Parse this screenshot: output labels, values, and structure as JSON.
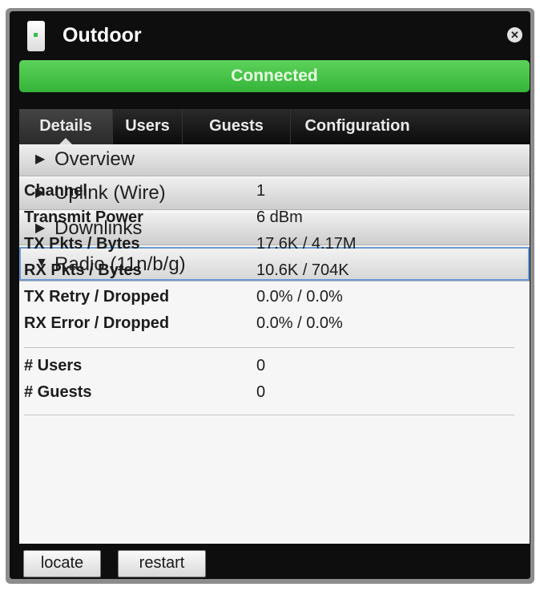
{
  "window": {
    "title": "Outdoor",
    "status": "Connected",
    "close_icon": "close-icon"
  },
  "tabs": [
    {
      "label": "Details",
      "active": true
    },
    {
      "label": "Users",
      "active": false
    },
    {
      "label": "Guests",
      "active": false
    },
    {
      "label": "Configuration",
      "active": false
    }
  ],
  "sections": [
    {
      "title": "Overview",
      "expanded": false
    },
    {
      "title": "Uplink (Wire)",
      "expanded": false
    },
    {
      "title": "Downlinks",
      "expanded": false
    },
    {
      "title": "Radio (11n/b/g)",
      "expanded": true
    }
  ],
  "radio": {
    "rows": [
      {
        "label": "Channel",
        "value": "1"
      },
      {
        "label": "Transmit Power",
        "value": "6 dBm"
      },
      {
        "label": "TX Pkts / Bytes",
        "value": "17.6K / 4.17M"
      },
      {
        "label": "RX Pkts / Bytes",
        "value": "10.6K / 704K"
      },
      {
        "label": "TX Retry / Dropped",
        "value": "0.0% / 0.0%"
      },
      {
        "label": "RX Error / Dropped",
        "value": "0.0% / 0.0%"
      }
    ],
    "client_rows": [
      {
        "label": "# Users",
        "value": "0"
      },
      {
        "label": "# Guests",
        "value": "0"
      }
    ]
  },
  "buttons": {
    "locate": "locate",
    "restart": "restart"
  },
  "colors": {
    "status_green": "#42c246",
    "window_bg": "#0e0e0e",
    "selection_border": "#6a9bd3"
  }
}
